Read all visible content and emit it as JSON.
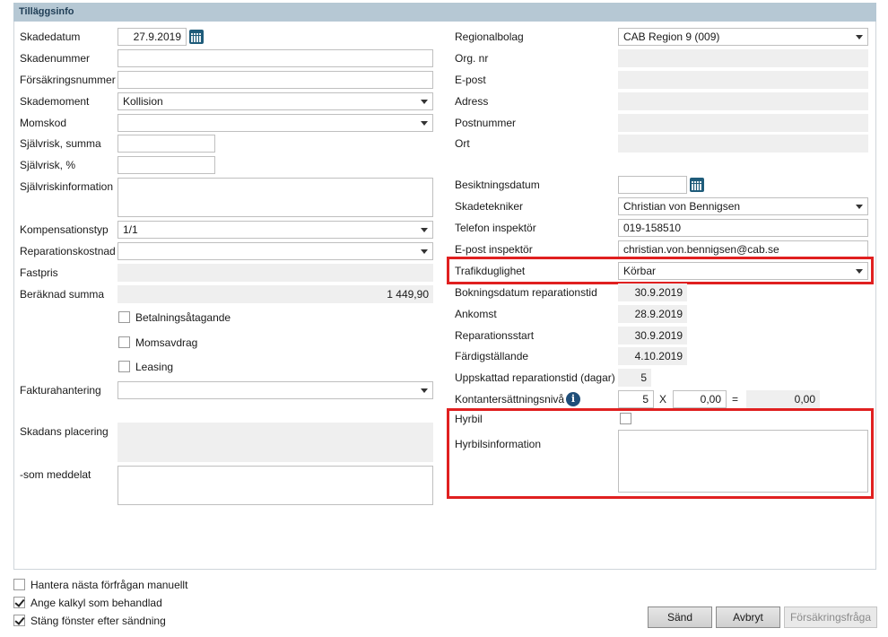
{
  "header": {
    "title": "Tilläggsinfo"
  },
  "left": {
    "skadedatum": {
      "label": "Skadedatum",
      "value": "27.9.2019"
    },
    "skadenummer": {
      "label": "Skadenummer",
      "value": ""
    },
    "forsakringsnummer": {
      "label": "Försäkringsnummer",
      "value": ""
    },
    "skademoment": {
      "label": "Skademoment",
      "value": "Kollision"
    },
    "momskod": {
      "label": "Momskod",
      "value": ""
    },
    "sjalvrisk_summa": {
      "label": "Självrisk, summa",
      "value": ""
    },
    "sjalvrisk_pct": {
      "label": "Självrisk, %",
      "value": ""
    },
    "sjalvriskinformation": {
      "label": "Självriskinformation"
    },
    "kompensationstyp": {
      "label": "Kompensationstyp",
      "value": "1/1"
    },
    "reparationskostnad": {
      "label": "Reparationskostnad",
      "value": ""
    },
    "fastpris": {
      "label": "Fastpris",
      "value": ""
    },
    "beraknad_summa": {
      "label": "Beräknad summa",
      "value": "1 449,90"
    },
    "betalningsatagande": {
      "label": "Betalningsåtagande",
      "checked": false
    },
    "momsavdrag": {
      "label": "Momsavdrag",
      "checked": false
    },
    "leasing": {
      "label": "Leasing",
      "checked": false
    },
    "fakturahantering": {
      "label": "Fakturahantering",
      "value": ""
    },
    "skadans_placering": {
      "label": "Skadans placering"
    },
    "som_meddelat": {
      "label": "-som meddelat"
    }
  },
  "right": {
    "regionalbolag": {
      "label": "Regionalbolag",
      "value": "CAB Region 9 (009)"
    },
    "org_nr": {
      "label": "Org. nr",
      "value": ""
    },
    "epost": {
      "label": "E-post",
      "value": ""
    },
    "adress": {
      "label": "Adress",
      "value": ""
    },
    "postnummer": {
      "label": "Postnummer",
      "value": ""
    },
    "ort": {
      "label": "Ort",
      "value": ""
    },
    "besiktningsdatum": {
      "label": "Besiktningsdatum",
      "value": ""
    },
    "skadetekniker": {
      "label": "Skadetekniker",
      "value": "Christian von Bennigsen"
    },
    "telefon_inspektor": {
      "label": "Telefon inspektör",
      "value": "019-158510"
    },
    "epost_inspektor": {
      "label": "E-post inspektör",
      "value": "christian.von.bennigsen@cab.se"
    },
    "trafikduglighet": {
      "label": "Trafikduglighet",
      "value": "Körbar"
    },
    "bokningsdatum": {
      "label": "Bokningsdatum reparationstid",
      "value": "30.9.2019"
    },
    "ankomst": {
      "label": "Ankomst",
      "value": "28.9.2019"
    },
    "reparationsstart": {
      "label": "Reparationsstart",
      "value": "30.9.2019"
    },
    "fardigstallande": {
      "label": "Färdigställande",
      "value": "4.10.2019"
    },
    "uppskattad": {
      "label": "Uppskattad reparationstid (dagar)",
      "value": "5"
    },
    "kontantersattning": {
      "label": "Kontantersättningsnivå",
      "value1": "5",
      "op1": "X",
      "value2": "0,00",
      "op2": "=",
      "result": "0,00"
    },
    "hyrbil": {
      "label": "Hyrbil",
      "checked": false
    },
    "hyrbilsinformation": {
      "label": "Hyrbilsinformation"
    }
  },
  "footer": {
    "hantera": {
      "label": "Hantera nästa förfrågan manuellt",
      "checked": false
    },
    "ange_kalkyl": {
      "label": "Ange kalkyl som behandlad",
      "checked": true
    },
    "stang_fonster": {
      "label": "Stäng fönster efter sändning",
      "checked": true
    },
    "buttons": {
      "send": "Sänd",
      "cancel": "Avbryt",
      "insurance_query": "Försäkringsfråga"
    }
  },
  "colors": {
    "header_bg": "#b6c8d4",
    "highlight": "#e02020",
    "readonly_bg": "#efefef"
  },
  "icons": {
    "calendar": "calendar-icon",
    "info": "info-icon",
    "dropdown": "chevron-down-icon"
  }
}
